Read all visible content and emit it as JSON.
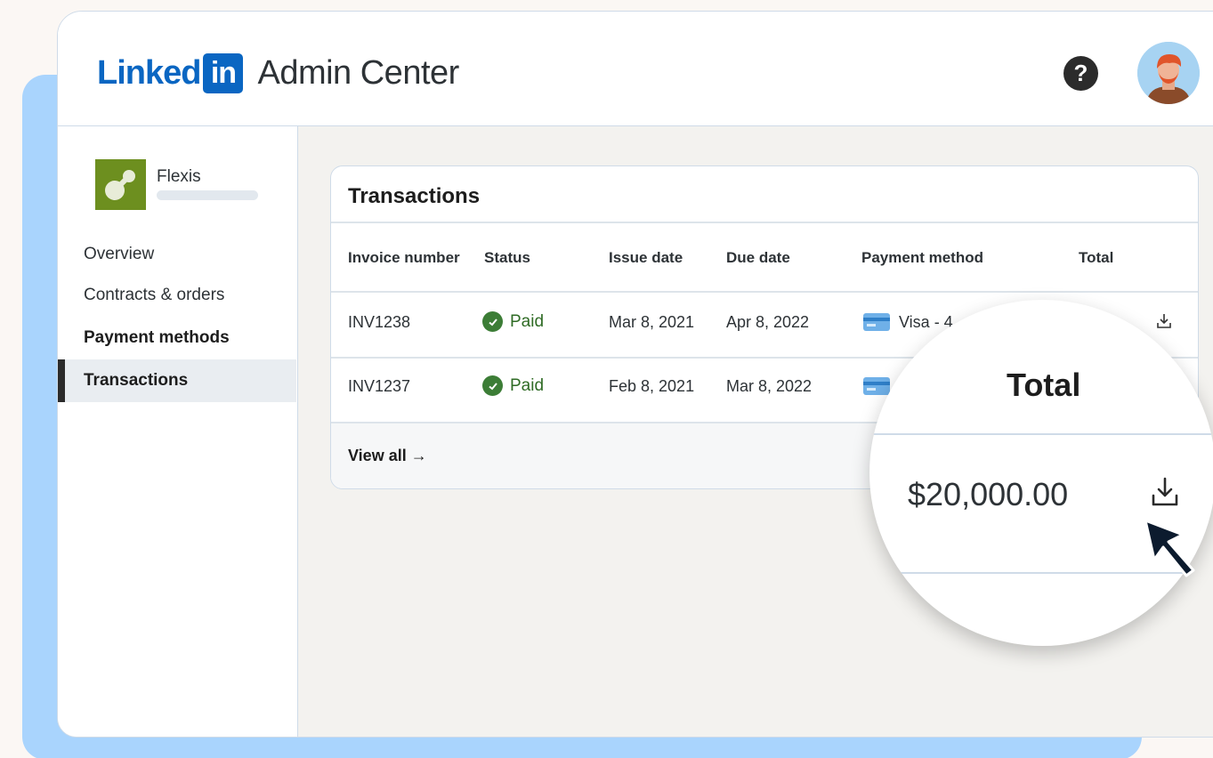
{
  "header": {
    "logo_linked": "Linked",
    "logo_in": "in",
    "app_title": "Admin Center",
    "help_icon": "question-circle-icon",
    "avatar_icon": "user-avatar"
  },
  "sidebar": {
    "org_name": "Flexis",
    "items": [
      {
        "label": "Overview"
      },
      {
        "label": "Contracts & orders"
      },
      {
        "label": "Payment methods"
      },
      {
        "label": "Transactions"
      }
    ]
  },
  "transactions": {
    "title": "Transactions",
    "columns": [
      "Invoice number",
      "Status",
      "Issue date",
      "Due date",
      "Payment method",
      "Total"
    ],
    "rows": [
      {
        "invoice": "INV1238",
        "status": "Paid",
        "issue_date": "Mar 8, 2021",
        "due_date": "Apr 8, 2022",
        "payment": "Visa - 4"
      },
      {
        "invoice": "INV1237",
        "status": "Paid",
        "issue_date": "Feb 8, 2021",
        "due_date": "Mar 8, 2022",
        "payment": ""
      }
    ],
    "view_all": "View all →"
  },
  "magnifier": {
    "title": "Total",
    "value": "$20,000.00",
    "icon": "download-icon"
  },
  "colors": {
    "linkedin_blue": "#0a66c2",
    "paid_green": "#3c7d36",
    "backdrop_blue": "#a9d4fd"
  }
}
